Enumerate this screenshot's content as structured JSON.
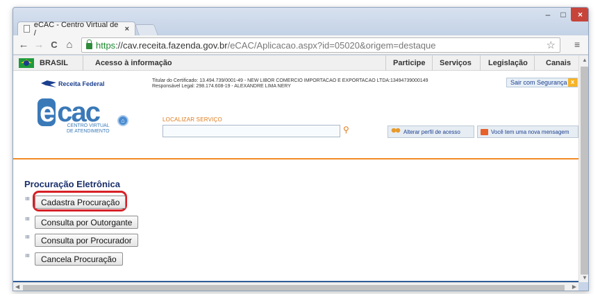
{
  "browser": {
    "tab_title": "eCAC - Centro Virtual de /",
    "tab_close": "×",
    "url_https": "https",
    "url_host": "://cav.receita.fazenda.gov.br",
    "url_path": "/eCAC/Aplicacao.aspx?id=05020&origem=destaque",
    "back": "←",
    "forward": "→",
    "reload": "C",
    "home": "⌂",
    "star": "☆",
    "menu": "≡",
    "minimize": "–",
    "maximize": "□",
    "close": "×"
  },
  "gov_bar": {
    "brasil": "BRASIL",
    "acesso": "Acesso à informação",
    "participe": "Participe",
    "servicos": "Serviços",
    "legislacao": "Legislação",
    "canais": "Canais"
  },
  "header": {
    "rf_logo": "Receita Federal",
    "cert_line1": "Titular do Certificado: 13.494.739/0001-49 - NEW LIBOR COMERCIO IMPORTACAO E EXPORTACAO LTDA:13494739000149",
    "cert_line2": "Responsável Legal: 298.174.608-19 - ALEXANDRE LIMA NERY",
    "sair": "Sair com Segurança",
    "sair_x": "x",
    "ecac_e": "e",
    "ecac_rest": "cac",
    "ecac_sub1": "CENTRO VIRTUAL",
    "ecac_sub2": "DE ATENDIMENTO",
    "localizar_label": "LOCALIZAR SERVIÇO",
    "localizar_value": "",
    "alterar_perfil": "Alterar perfil de acesso",
    "nova_mensagem": "Você tem uma nova mensagem"
  },
  "content": {
    "title": "Procuração Eletrônica",
    "buttons": [
      "Cadastra Procuração",
      "Consulta por Outorgante",
      "Consulta por Procurador",
      "Cancela Procuração"
    ]
  },
  "colors": {
    "highlight": "#d61f26",
    "accent_orange": "#f08a24",
    "brand_blue": "#1b3f8f"
  }
}
